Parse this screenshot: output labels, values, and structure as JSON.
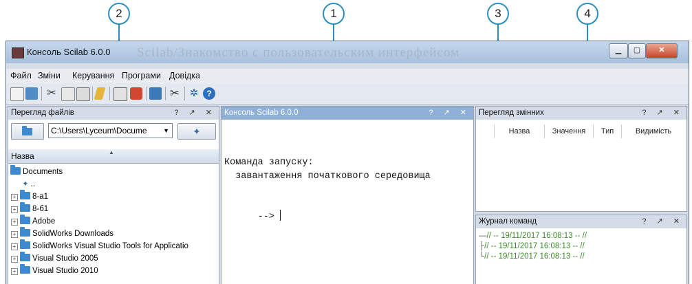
{
  "callouts": [
    "2",
    "1",
    "3",
    "4"
  ],
  "window": {
    "title": "Консоль Scilab 6.0.0",
    "watermark": "Scilab/Знакомство с пользовательским интерфейсом"
  },
  "menu": [
    "Файл",
    "Зміни",
    "Керування",
    "Програми",
    "Довідка"
  ],
  "toolbar_icons": [
    "new-script-icon",
    "open-file-icon",
    "cut-icon",
    "copy-icon",
    "paste-icon",
    "change-directory-icon",
    "print-icon",
    "module-manager-icon",
    "xcos-icon",
    "demos-icon",
    "atoms-icon",
    "help-icon"
  ],
  "file_browser": {
    "title": "Перегляд файлів",
    "controls": "? ↗ ✕",
    "path": "C:\\Users\\Lyceum\\Docume",
    "column": "Назва",
    "root": "Documents",
    "up": "..",
    "items": [
      "8-а1",
      "8-б1",
      "Adobe",
      "SolidWorks Downloads",
      "SolidWorks Visual Studio Tools for Applicatio",
      "Visual Studio 2005",
      "Visual Studio 2010"
    ]
  },
  "console": {
    "title": "Консоль Scilab 6.0.0",
    "controls": "? ↗ ✕",
    "line1": "Команда запуску:",
    "line2": "  завантаження початкового середовища",
    "prompt": "-->"
  },
  "variables": {
    "title": "Перегляд змінних",
    "controls": "? ↗ ✕",
    "columns": [
      "Назва",
      "Значення",
      "Тип",
      "Видимість"
    ]
  },
  "history": {
    "title": "Журнал команд",
    "controls": "? ↗ ✕",
    "entries": [
      "// -- 19/11/2017 16:08:13 -- //",
      "// -- 19/11/2017 16:08:13 -- //",
      "// -- 19/11/2017 16:08:13 -- //"
    ]
  }
}
